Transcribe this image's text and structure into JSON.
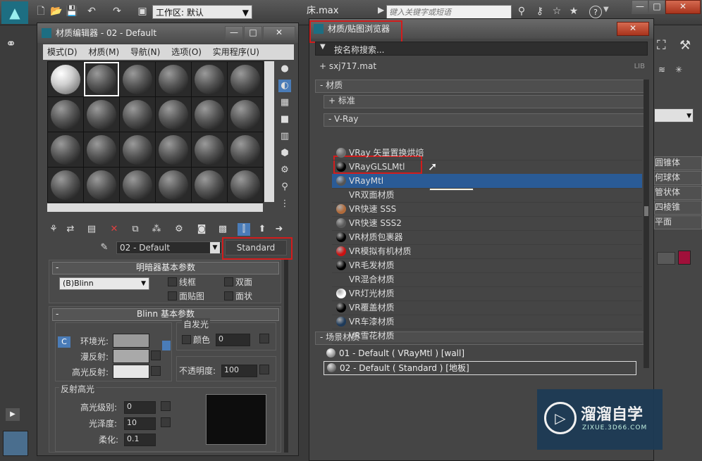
{
  "app": {
    "workspace_combo": "工作区: 默认",
    "file_title": "床.max",
    "search_placeholder": "键入关键字或短语",
    "help_icon": "?",
    "win_min": "—",
    "win_max": "□",
    "win_close": "✕"
  },
  "mated": {
    "title": "材质编辑器 - 02 - Default",
    "menus": [
      "模式(D)",
      "材质(M)",
      "导航(N)",
      "选项(O)",
      "实用程序(U)"
    ],
    "material_name": "02 - Default",
    "material_type_button": "Standard",
    "shader_rollout": {
      "title": "明暗器基本参数",
      "shader": "(B)Blinn",
      "wireframe": "线框",
      "two_sided": "双面",
      "face_map": "面贴图",
      "faceted": "面状"
    },
    "blinn_rollout": {
      "title": "Blinn 基本参数",
      "self_illum_group": "自发光",
      "color_label": "颜色",
      "color_value": "0",
      "ambient": "环境光:",
      "diffuse": "漫反射:",
      "specular": "高光反射:",
      "opacity_label": "不透明度:",
      "opacity_value": "100",
      "lock_icon": "C"
    },
    "spec_highlights": {
      "title": "反射高光",
      "spec_level_label": "高光级别:",
      "spec_level": "0",
      "glossiness_label": "光泽度:",
      "glossiness": "10",
      "soften_label": "柔化:",
      "soften": "0.1"
    }
  },
  "browser": {
    "title": "材质/贴图浏览器",
    "search_by_name": "按名称搜索...",
    "library": "+ sxj717.mat",
    "library_tag": "LIB",
    "materials_cat": "- 材质",
    "standard_cat": "+ 标准",
    "vray_cat": "- V-Ray",
    "vray_items": [
      {
        "label": "VRay 矢量置换烘焙",
        "color": "#6a6a6a"
      },
      {
        "label": "VRayGLSLMtl",
        "color": "#000000"
      },
      {
        "label": "VRayMtl",
        "color": "#555555"
      },
      {
        "label": "VR双面材质",
        "color": ""
      },
      {
        "label": "VR快速 SSS",
        "color": "#b06a3a"
      },
      {
        "label": "VR快速 SSS2",
        "color": "#5a5a5a"
      },
      {
        "label": "VR材质包裹器",
        "color": "#000000"
      },
      {
        "label": "VR模拟有机材质",
        "color": "#cc1111"
      },
      {
        "label": "VR毛发材质",
        "color": "#000000"
      },
      {
        "label": "VR混合材质",
        "color": ""
      },
      {
        "label": "VR灯光材质",
        "color": "#ffffff"
      },
      {
        "label": "VR覆盖材质",
        "color": "#000000"
      },
      {
        "label": "VR车漆材质",
        "color": "#1e3a5a"
      },
      {
        "label": "VR雪花材质",
        "color": ""
      }
    ],
    "tooltip": "VRayMtl",
    "scene_cat": "- 场景材质",
    "scene_items": [
      "01 - Default  ( VRayMtl )  [wall]",
      "02 - Default  ( Standard )  [地板]"
    ]
  },
  "right_panel": {
    "items": [
      "圆锥体",
      "何球体",
      "管状体",
      "四棱锥",
      "平面"
    ]
  },
  "watermark": {
    "brand": "溜溜自学",
    "url": "ZIXUE.3D66.COM"
  },
  "colors": {
    "highlight_blue": "#2a5b96",
    "red_marker": "#d21c1c",
    "accent_swatch": "#a0103a"
  }
}
